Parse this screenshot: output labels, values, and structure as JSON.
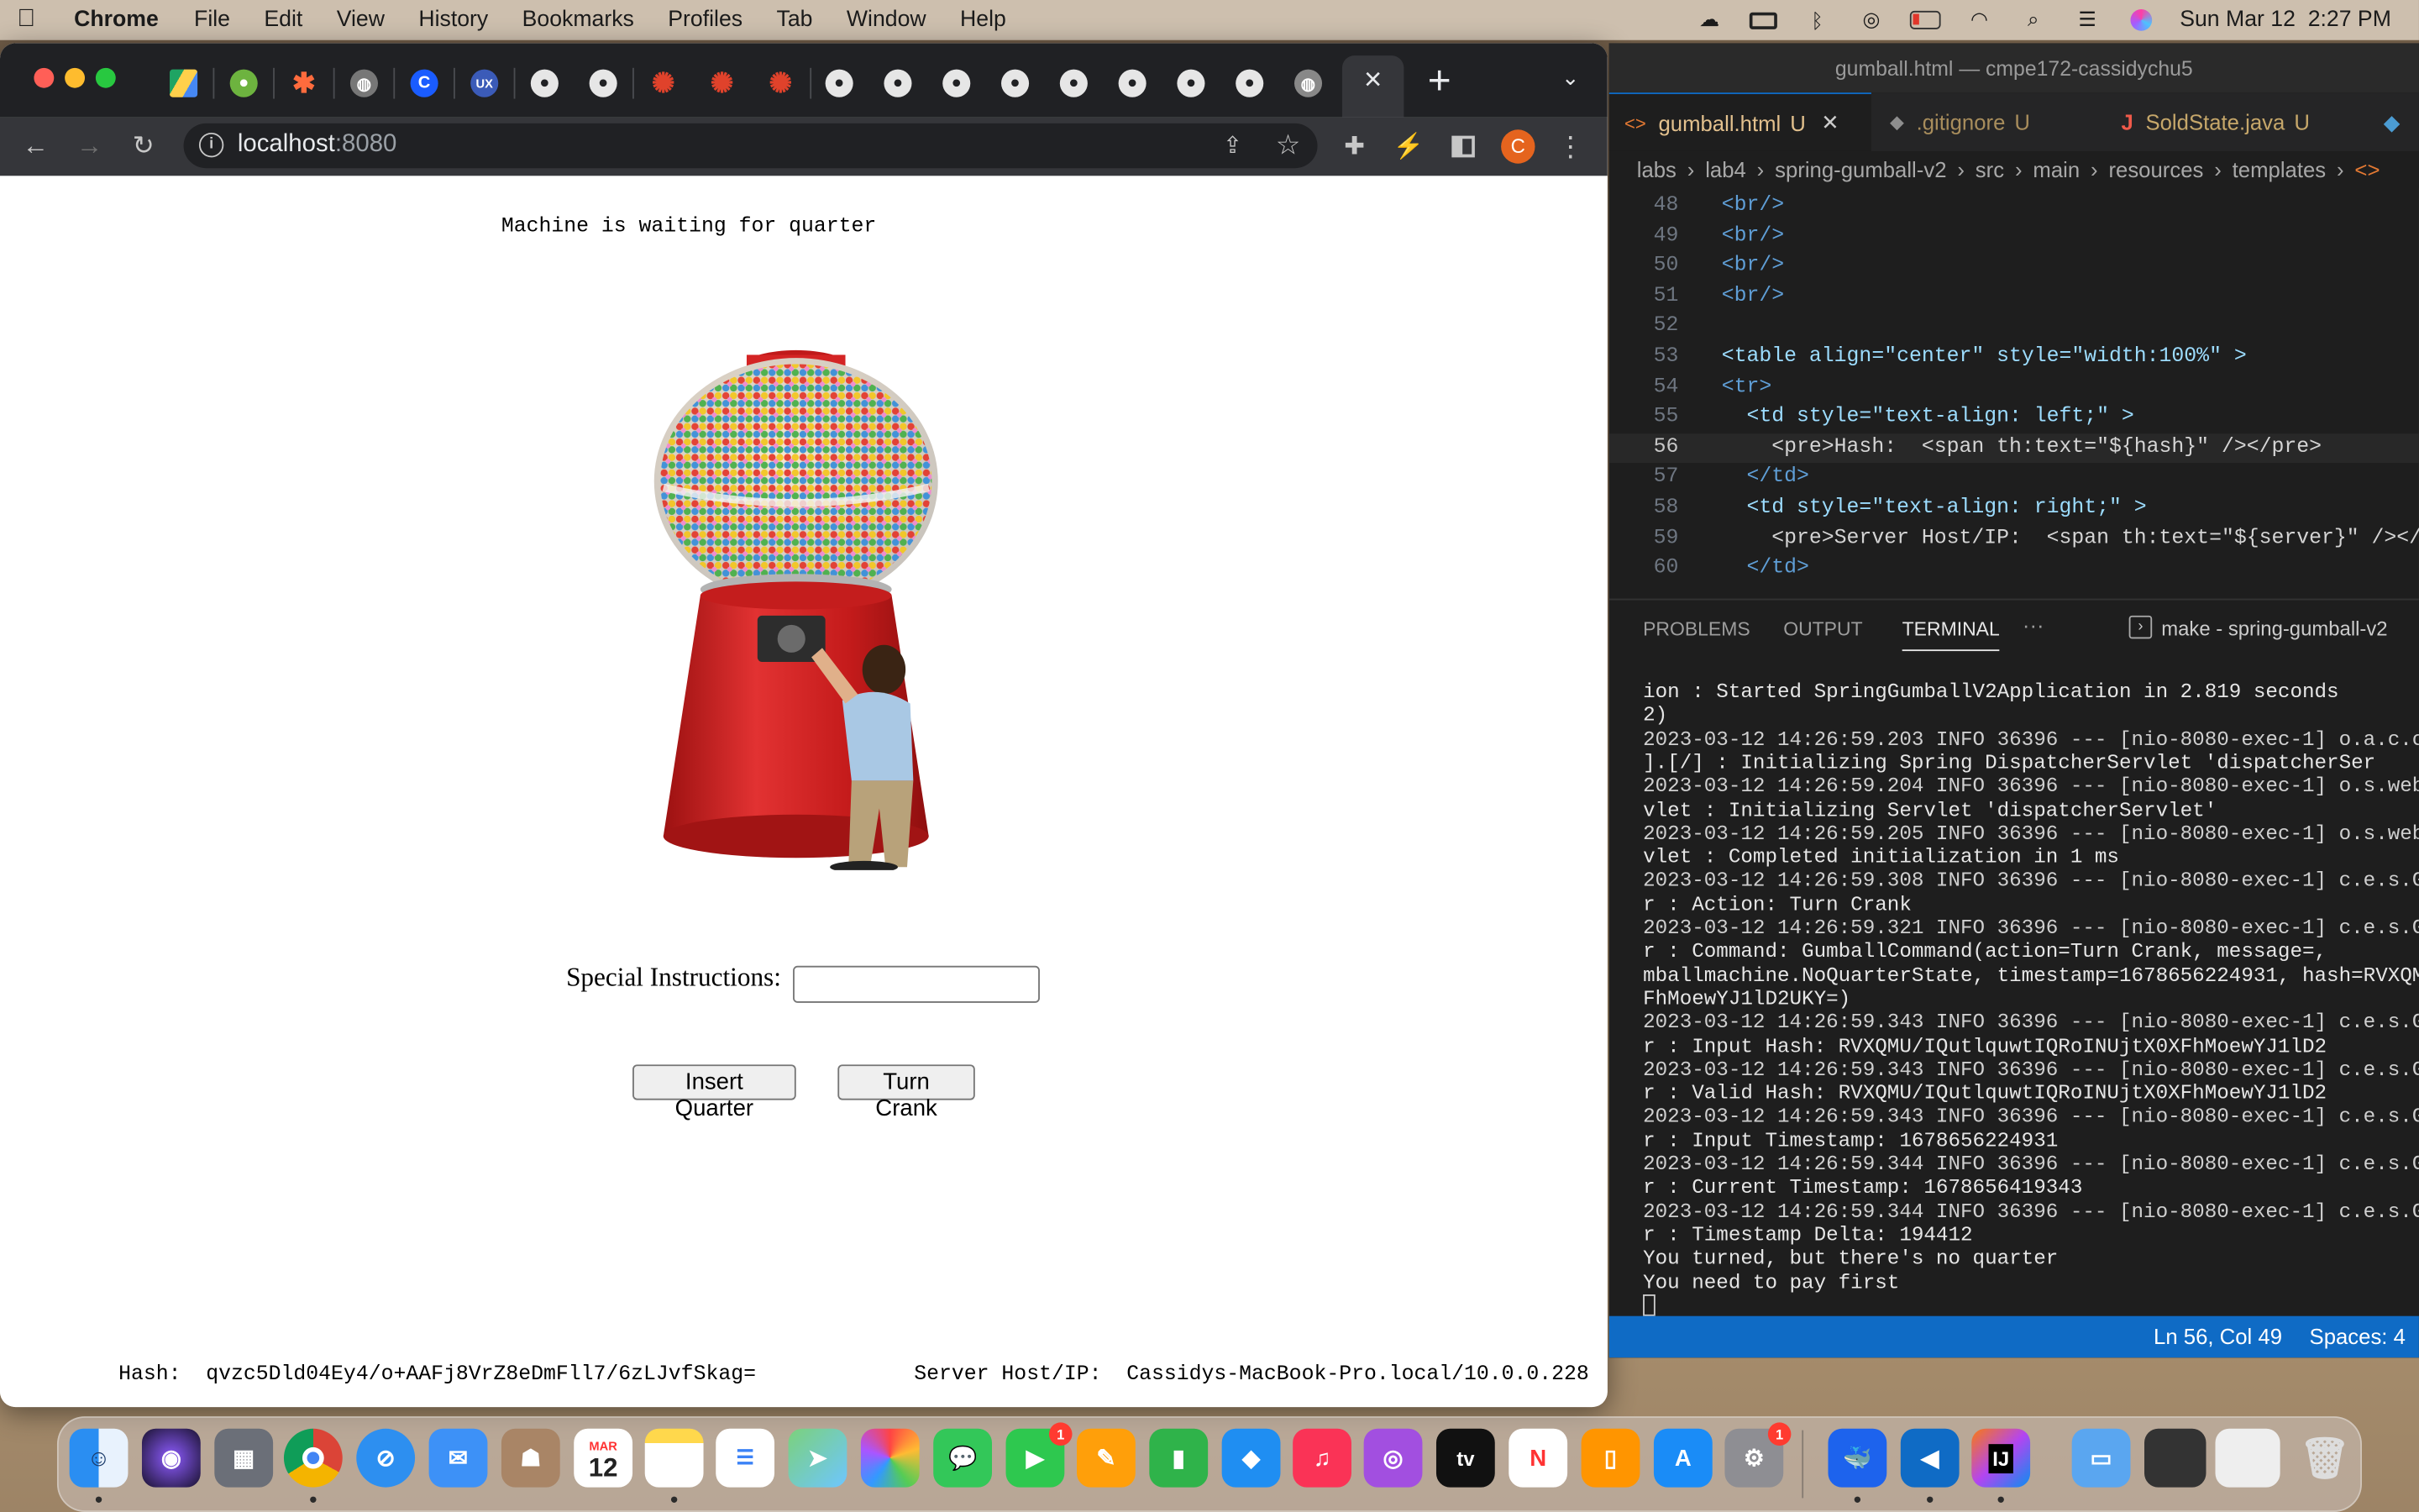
{
  "menubar": {
    "app_name": "Chrome",
    "menus": [
      "File",
      "Edit",
      "View",
      "History",
      "Bookmarks",
      "Profiles",
      "Tab",
      "Window",
      "Help"
    ],
    "datetime": "Sun Mar 12  2:27 PM"
  },
  "chrome": {
    "url_host": "localhost",
    "url_port": ":8080",
    "profile_initial": "C",
    "new_tab_symbol": "+",
    "close_symbol": "×"
  },
  "gumball_page": {
    "state_message": "Machine is waiting for quarter",
    "special_label": "Special Instructions:",
    "special_value": "",
    "insert_button": "Insert Quarter",
    "crank_button": "Turn Crank",
    "hash_label": "Hash:",
    "hash_value": "qvzc5Dld04Ey4/o+AAFj8VrZ8eDmFll7/6zLJvfSkag=",
    "server_label": "Server Host/IP:",
    "server_value": "Cassidys-MacBook-Pro.local/10.0.0.228"
  },
  "vscode": {
    "window_title": "gumball.html — cmpe172-cassidychu5",
    "tabs": [
      {
        "label": "gumball.html",
        "status": "U",
        "color": "#e2c08d"
      },
      {
        "label": ".gitignore",
        "status": "U",
        "color": "#a88d5c"
      },
      {
        "label": "SoldState.java",
        "status": "U",
        "color": "#c6a76a"
      }
    ],
    "breadcrumbs": [
      "labs",
      "lab4",
      "spring-gumball-v2",
      "src",
      "main",
      "resources",
      "templates"
    ],
    "code_lines": [
      {
        "n": "48",
        "t": "<br/>"
      },
      {
        "n": "49",
        "t": "<br/>"
      },
      {
        "n": "50",
        "t": "<br/>"
      },
      {
        "n": "51",
        "t": "<br/>"
      },
      {
        "n": "52",
        "t": ""
      },
      {
        "n": "53",
        "t": "<table align=\"center\" style=\"width:100%\" >"
      },
      {
        "n": "54",
        "t": "<tr>"
      },
      {
        "n": "55",
        "t": "  <td style=\"text-align: left;\" >"
      },
      {
        "n": "56",
        "t": "    <pre>Hash:  <span th:text=\"${hash}\" /></pre>"
      },
      {
        "n": "57",
        "t": "  </td>"
      },
      {
        "n": "58",
        "t": "  <td style=\"text-align: right;\" >"
      },
      {
        "n": "59",
        "t": "    <pre>Server Host/IP:  <span th:text=\"${server}\" /></pre>"
      },
      {
        "n": "60",
        "t": "  </td>"
      }
    ],
    "panel_tabs": [
      "PROBLEMS",
      "OUTPUT",
      "TERMINAL"
    ],
    "panel_more": "···",
    "terminal_name": "make - spring-gumball-v2",
    "terminal_lines": [
      "ion         : Started SpringGumballV2Application in 2.819 seconds",
      "2)",
      "2023-03-12 14:26:59.203  INFO 36396 --- [nio-8080-exec-1] o.a.c.c.",
      "].[/]       : Initializing Spring DispatcherServlet 'dispatcherSer",
      "2023-03-12 14:26:59.204  INFO 36396 --- [nio-8080-exec-1] o.s.web.",
      "vlet        : Initializing Servlet 'dispatcherServlet'",
      "2023-03-12 14:26:59.205  INFO 36396 --- [nio-8080-exec-1] o.s.web.",
      "vlet        : Completed initialization in 1 ms",
      "2023-03-12 14:26:59.308  INFO 36396 --- [nio-8080-exec-1] c.e.s.Gu",
      "r           : Action: Turn Crank",
      "2023-03-12 14:26:59.321  INFO 36396 --- [nio-8080-exec-1] c.e.s.Gu",
      "r           : Command: GumballCommand(action=Turn Crank, message=,",
      "mballmachine.NoQuarterState, timestamp=1678656224931, hash=RVXQMU/",
      "FhMoewYJ1lD2UKY=)",
      "2023-03-12 14:26:59.343  INFO 36396 --- [nio-8080-exec-1] c.e.s.Gu",
      "r           : Input Hash: RVXQMU/IQutlquwtIQRoINUjtX0XFhMoewYJ1lD2",
      "2023-03-12 14:26:59.343  INFO 36396 --- [nio-8080-exec-1] c.e.s.Gu",
      "r           : Valid Hash: RVXQMU/IQutlquwtIQRoINUjtX0XFhMoewYJ1lD2",
      "2023-03-12 14:26:59.343  INFO 36396 --- [nio-8080-exec-1] c.e.s.Gu",
      "r           : Input Timestamp: 1678656224931",
      "2023-03-12 14:26:59.344  INFO 36396 --- [nio-8080-exec-1] c.e.s.Gu",
      "r           : Current Timestamp: 1678656419343",
      "2023-03-12 14:26:59.344  INFO 36396 --- [nio-8080-exec-1] c.e.s.Gu",
      "r           : Timestamp Delta: 194412",
      "You turned, but there's no quarter",
      "You need to pay first"
    ],
    "status_position": "Ln 56, Col 49",
    "status_spaces": "Spaces: 4"
  },
  "dock": {
    "calendar_month": "MAR",
    "calendar_day": "12",
    "facetime_badge": "1",
    "settings_badge": "1",
    "appletv_label": "tv",
    "intellij_label": "IJ"
  },
  "colors": {
    "menubar_bg": "#cdbfae",
    "chrome_dark": "#202124",
    "vscode_bg": "#1e1e1e",
    "statusbar": "#0f6bc5",
    "gumball_red": "#d01e1e"
  }
}
